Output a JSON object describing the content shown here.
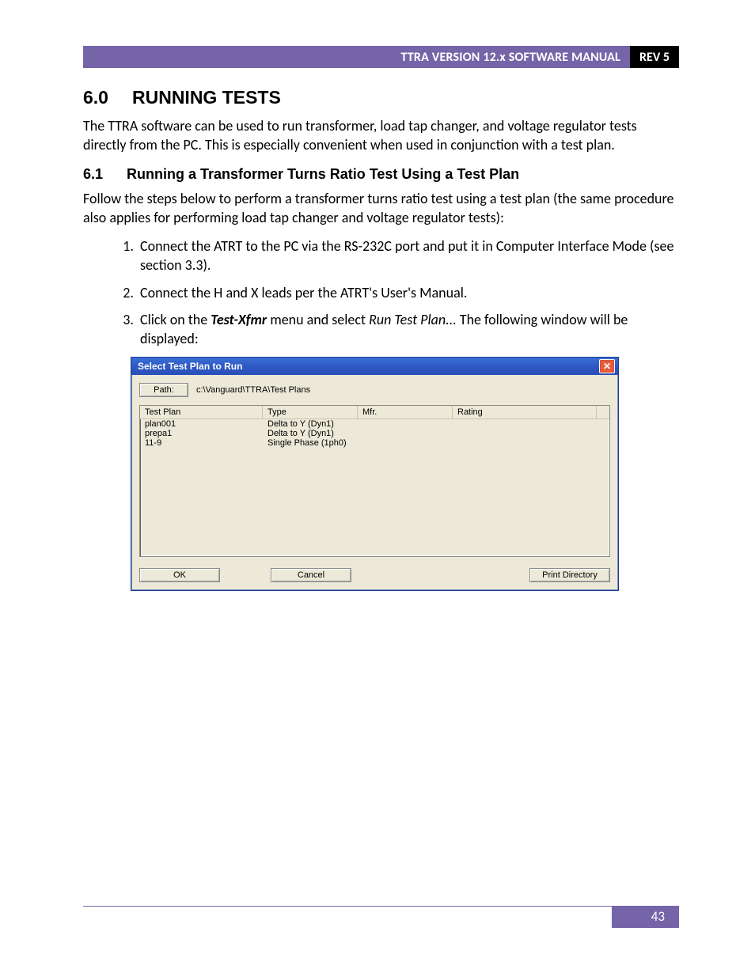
{
  "header": {
    "title": "TTRA VERSION 12.x SOFTWARE MANUAL",
    "rev": "REV 5"
  },
  "section": {
    "num": "6.0",
    "title": "RUNNING TESTS",
    "intro": "The TTRA software can be used to run transformer, load tap changer, and voltage regulator tests directly from the PC. This is especially convenient when used in conjunction with a test plan."
  },
  "subsection": {
    "num": "6.1",
    "title": "Running a Transformer Turns Ratio Test Using a Test Plan",
    "intro": "Follow the steps below to perform a transformer turns ratio test using a test plan (the same procedure also applies for performing load tap changer and voltage regulator tests):"
  },
  "steps": {
    "s1a": "Connect the ATRT to the PC via the RS-232C port and put it in Computer Interface Mode (see section 3.3).",
    "s2a": "Connect the H and X leads per the ATRT's User's Manual.",
    "s3a": "Click on the ",
    "s3b": "Test-Xfmr",
    "s3c": " menu and select ",
    "s3d": "Run Test Plan...",
    "s3e": " The following window will be displayed:"
  },
  "dialog": {
    "title": "Select Test Plan to Run",
    "close": "✕",
    "path_btn": "Path:",
    "path_value": "c:\\Vanguard\\TTRA\\Test Plans",
    "cols": {
      "plan": "Test Plan",
      "type": "Type",
      "mfr": "Mfr.",
      "rating": "Rating"
    },
    "rows": [
      {
        "plan": "plan001",
        "type": "Delta to Y (Dyn1)",
        "mfr": "",
        "rating": ""
      },
      {
        "plan": "prepa1",
        "type": "Delta to Y (Dyn1)",
        "mfr": "",
        "rating": ""
      },
      {
        "plan": "11-9",
        "type": "Single Phase (1ph0)",
        "mfr": "",
        "rating": ""
      }
    ],
    "ok": "OK",
    "cancel": "Cancel",
    "print": "Print Directory"
  },
  "footer": {
    "page": "43"
  }
}
